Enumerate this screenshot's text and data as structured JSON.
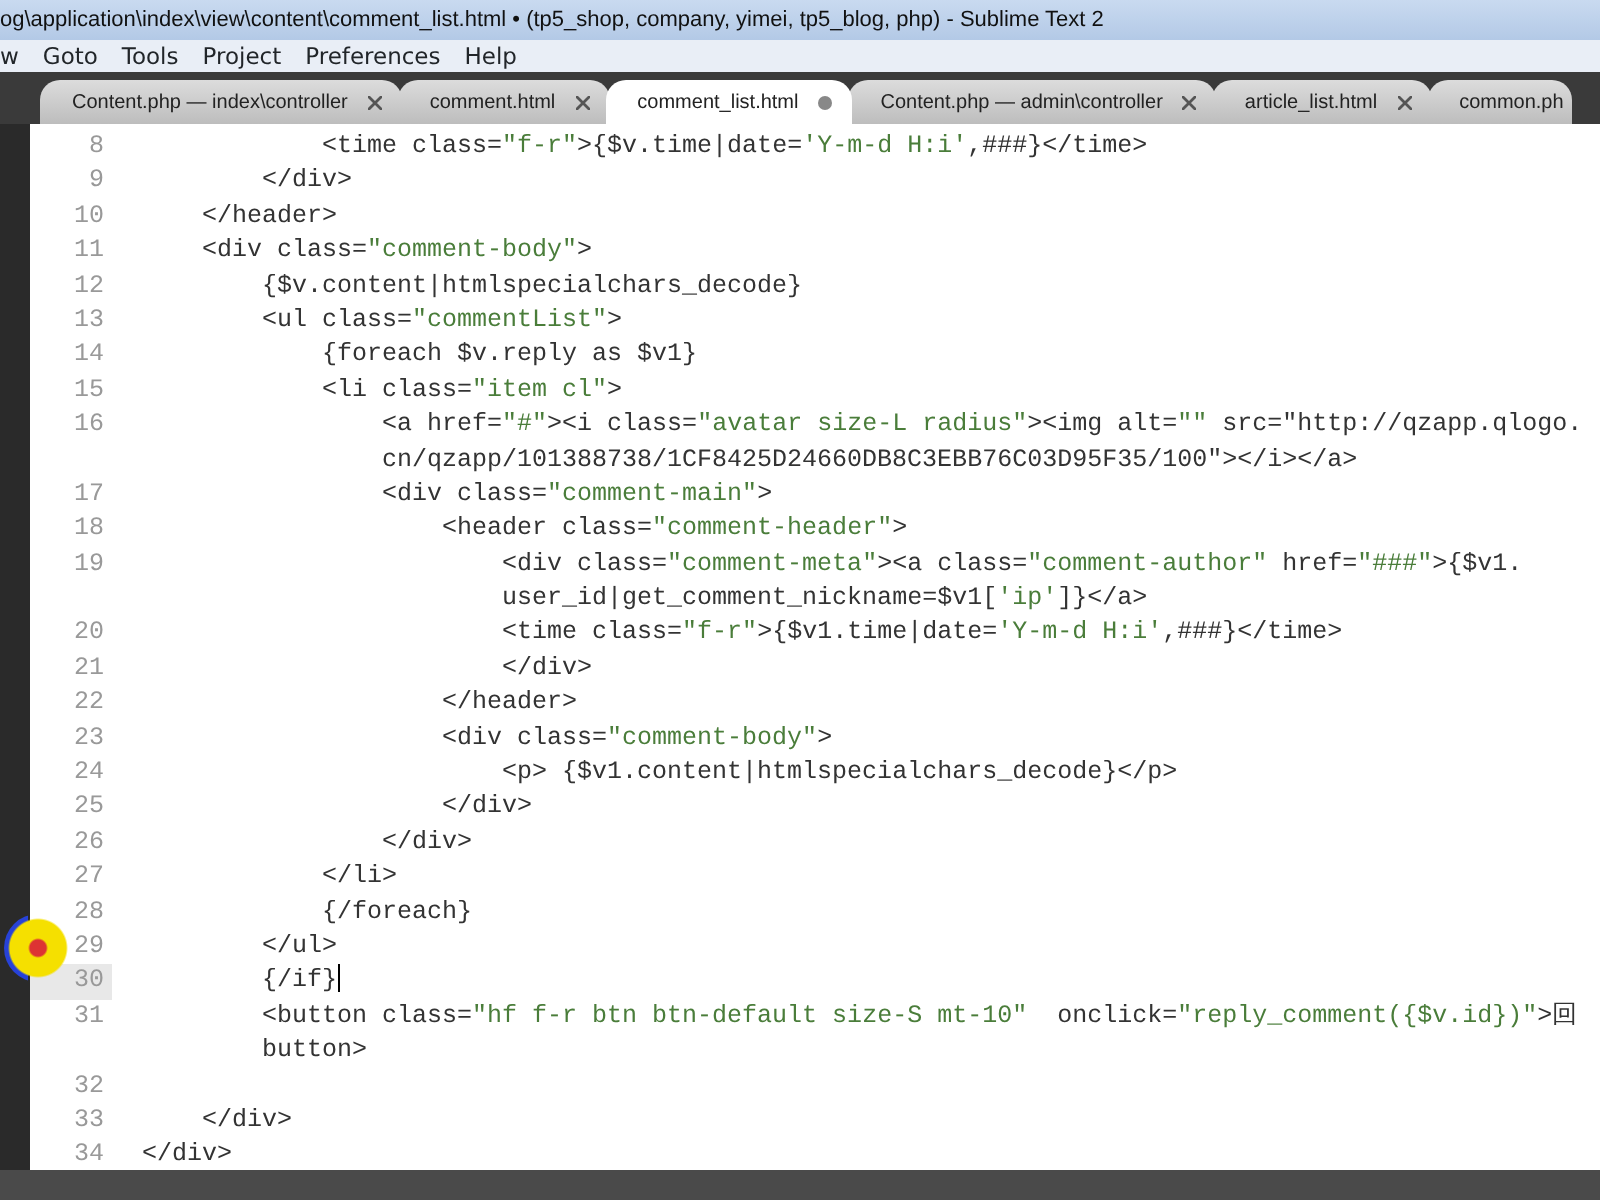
{
  "window": {
    "title": "og\\application\\index\\view\\content\\comment_list.html • (tp5_shop, company, yimei, tp5_blog, php) - Sublime Text 2"
  },
  "menu": [
    "w",
    "Goto",
    "Tools",
    "Project",
    "Preferences",
    "Help"
  ],
  "tabs": [
    {
      "label": "Content.php — index\\controller",
      "selected": false,
      "modified": false
    },
    {
      "label": "comment.html",
      "selected": false,
      "modified": false
    },
    {
      "label": "comment_list.html",
      "selected": true,
      "modified": true
    },
    {
      "label": "Content.php — admin\\controller",
      "selected": false,
      "modified": false
    },
    {
      "label": "article_list.html",
      "selected": false,
      "modified": false
    },
    {
      "label": "common.ph",
      "selected": false
    }
  ],
  "editor": {
    "lines": [
      {
        "number": "8",
        "text": "            <time class=\"f-r\">{$v.time|date='Y-m-d H:i',###}</time>"
      },
      {
        "number": "9",
        "text": "        </div>"
      },
      {
        "number": "10",
        "text": "    </header>"
      },
      {
        "number": "11",
        "text": "    <div class=\"comment-body\">"
      },
      {
        "number": "12",
        "text": "        {$v.content|htmlspecialchars_decode}"
      },
      {
        "number": "13",
        "text": "        <ul class=\"commentList\">"
      },
      {
        "number": "14",
        "text": "            {foreach $v.reply as $v1}"
      },
      {
        "number": "15",
        "text": "            <li class=\"item cl\">"
      },
      {
        "number": "16",
        "text": "                <a href=\"#\"><i class=\"avatar size-L radius\"><img alt=\"\" src=\"http://qzapp.qlogo."
      },
      {
        "text": "                cn/qzapp/101388738/1CF8425D24660DB8C3EBB76C03D95F35/100\"></i></a>"
      },
      {
        "number": "17",
        "text": "                <div class=\"comment-main\">"
      },
      {
        "number": "18",
        "text": "                    <header class=\"comment-header\">"
      },
      {
        "number": "19",
        "text": "                        <div class=\"comment-meta\"><a class=\"comment-author\" href=\"###\">{$v1."
      },
      {
        "text": "                        user_id|get_comment_nickname=$v1['ip']}</a>"
      },
      {
        "number": "20",
        "text": "                        <time class=\"f-r\">{$v1.time|date='Y-m-d H:i',###}</time>"
      },
      {
        "number": "21",
        "text": "                        </div>"
      },
      {
        "number": "22",
        "text": "                    </header>"
      },
      {
        "number": "23",
        "text": "                    <div class=\"comment-body\">"
      },
      {
        "number": "24",
        "text": "                        <p> {$v1.content|htmlspecialchars_decode}</p>"
      },
      {
        "number": "25",
        "text": "                    </div>"
      },
      {
        "number": "26",
        "text": "                </div>"
      },
      {
        "number": "27",
        "text": "            </li>"
      },
      {
        "number": "28",
        "text": "            {/foreach}"
      },
      {
        "number": "29",
        "text": "        </ul>"
      },
      {
        "number": "30",
        "text": "        {/if}",
        "current": true
      },
      {
        "number": "31",
        "text": "        <button class=\"hf f-r btn btn-default size-S mt-10\"  onclick=\"reply_comment({$v.id})\">回"
      },
      {
        "text": "        button>"
      },
      {
        "number": "32"
      },
      {
        "number": "33",
        "text": "    </div>"
      },
      {
        "number": "34",
        "text": "</div>"
      }
    ]
  }
}
